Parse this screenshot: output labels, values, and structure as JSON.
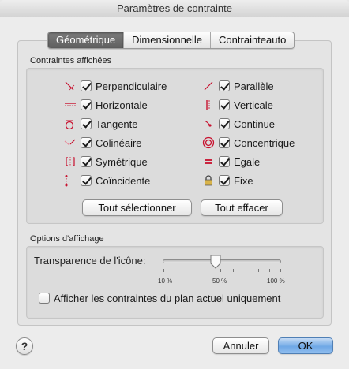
{
  "window": {
    "title": "Paramètres de contrainte"
  },
  "tabs": [
    {
      "label": "Géométrique",
      "active": true
    },
    {
      "label": "Dimensionnelle",
      "active": false
    },
    {
      "label": "Contrainteauto",
      "active": false
    }
  ],
  "constraints": {
    "section_label": "Contraintes affichées",
    "items": [
      {
        "label": "Perpendiculaire",
        "checked": true,
        "icon": "perpendicular-icon"
      },
      {
        "label": "Parallèle",
        "checked": true,
        "icon": "parallel-icon"
      },
      {
        "label": "Horizontale",
        "checked": true,
        "icon": "horizontal-icon"
      },
      {
        "label": "Verticale",
        "checked": true,
        "icon": "vertical-icon"
      },
      {
        "label": "Tangente",
        "checked": true,
        "icon": "tangent-icon"
      },
      {
        "label": "Continue",
        "checked": true,
        "icon": "smooth-icon"
      },
      {
        "label": "Colinéaire",
        "checked": true,
        "icon": "collinear-icon"
      },
      {
        "label": "Concentrique",
        "checked": true,
        "icon": "concentric-icon"
      },
      {
        "label": "Symétrique",
        "checked": true,
        "icon": "symmetric-icon"
      },
      {
        "label": "Egale",
        "checked": true,
        "icon": "equal-icon"
      },
      {
        "label": "Coïncidente",
        "checked": true,
        "icon": "coincident-icon"
      },
      {
        "label": "Fixe",
        "checked": true,
        "icon": "lock-icon"
      }
    ],
    "select_all_label": "Tout sélectionner",
    "clear_all_label": "Tout effacer"
  },
  "display_options": {
    "section_label": "Options d'affichage",
    "transparency_label": "Transparence de l'icône:",
    "transparency_value_percent": 50,
    "ticks": [
      "10 %",
      "50 %",
      "100 %"
    ],
    "current_plane_only_label": "Afficher les contraintes du plan actuel uniquement",
    "current_plane_only_checked": false
  },
  "footer": {
    "help_label": "?",
    "cancel_label": "Annuler",
    "ok_label": "OK"
  },
  "colors": {
    "accent_red": "#c8102e",
    "default_button_blue": "#6fa8e6",
    "active_tab": "#6a6a6a"
  }
}
